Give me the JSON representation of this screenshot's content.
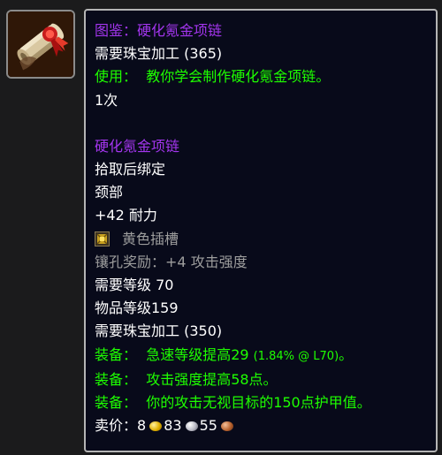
{
  "icon": {
    "name": "scroll-recipe-icon"
  },
  "tooltip": {
    "recipe_name": "图鉴：硬化氪金项链",
    "recipe_requires_skill": "需要珠宝加工 (365)",
    "use_label": "使用：",
    "use_text": "教你学会制作硬化氪金项链。",
    "charges": "1次",
    "item_name": "硬化氪金项链",
    "binding": "拾取后绑定",
    "slot": "颈部",
    "stat_value": "+42",
    "stat_name": "耐力",
    "socket_color": "黄色插槽",
    "socket_bonus_label": "镶孔奖励：",
    "socket_bonus_value": "+4 攻击强度",
    "req_level_label": "需要等级",
    "req_level_value": "70",
    "item_level": "物品等级159",
    "item_requires_skill": "需要珠宝加工 (350)",
    "equip_label": "装备：",
    "equip1_text": "急速等级提高29",
    "equip1_detail": "(1.84% @ L70)",
    "equip1_end": "。",
    "equip2_text": "攻击强度提高58点。",
    "equip3_text": "你的攻击无视目标的150点护甲值。",
    "sell_label": "卖价：",
    "gold": "8",
    "silver": "83",
    "copper": "55"
  },
  "colors": {
    "epic_purple": "#a335ee",
    "green": "#1eff00",
    "grey": "#9d9d9d",
    "tooltip_bg": "#080a1a"
  }
}
